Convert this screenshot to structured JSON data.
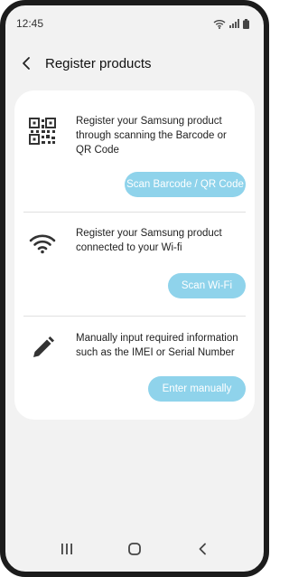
{
  "status_bar": {
    "time": "12:45",
    "icons": [
      "wifi-icon",
      "signal-icon",
      "battery-icon"
    ]
  },
  "app_bar": {
    "back_icon": "back-arrow-icon",
    "title": "Register products"
  },
  "options": [
    {
      "icon": "qr-code-icon",
      "text": "Register your Samsung product through scanning the Barcode or QR Code",
      "button": "Scan Barcode / QR Code"
    },
    {
      "icon": "wifi-icon",
      "text": "Register your Samsung product connected to your Wi-fi",
      "button": "Scan Wi-Fi"
    },
    {
      "icon": "pencil-icon",
      "text": "Manually input required information such as the IMEI or Serial Number",
      "button": "Enter manually"
    }
  ],
  "nav_bar": {
    "items": [
      "recent-apps-icon",
      "home-icon",
      "back-icon"
    ]
  },
  "colors": {
    "background": "#f2f2f2",
    "card": "#ffffff",
    "button": "#8fd3eb",
    "button_text": "#ffffff"
  }
}
